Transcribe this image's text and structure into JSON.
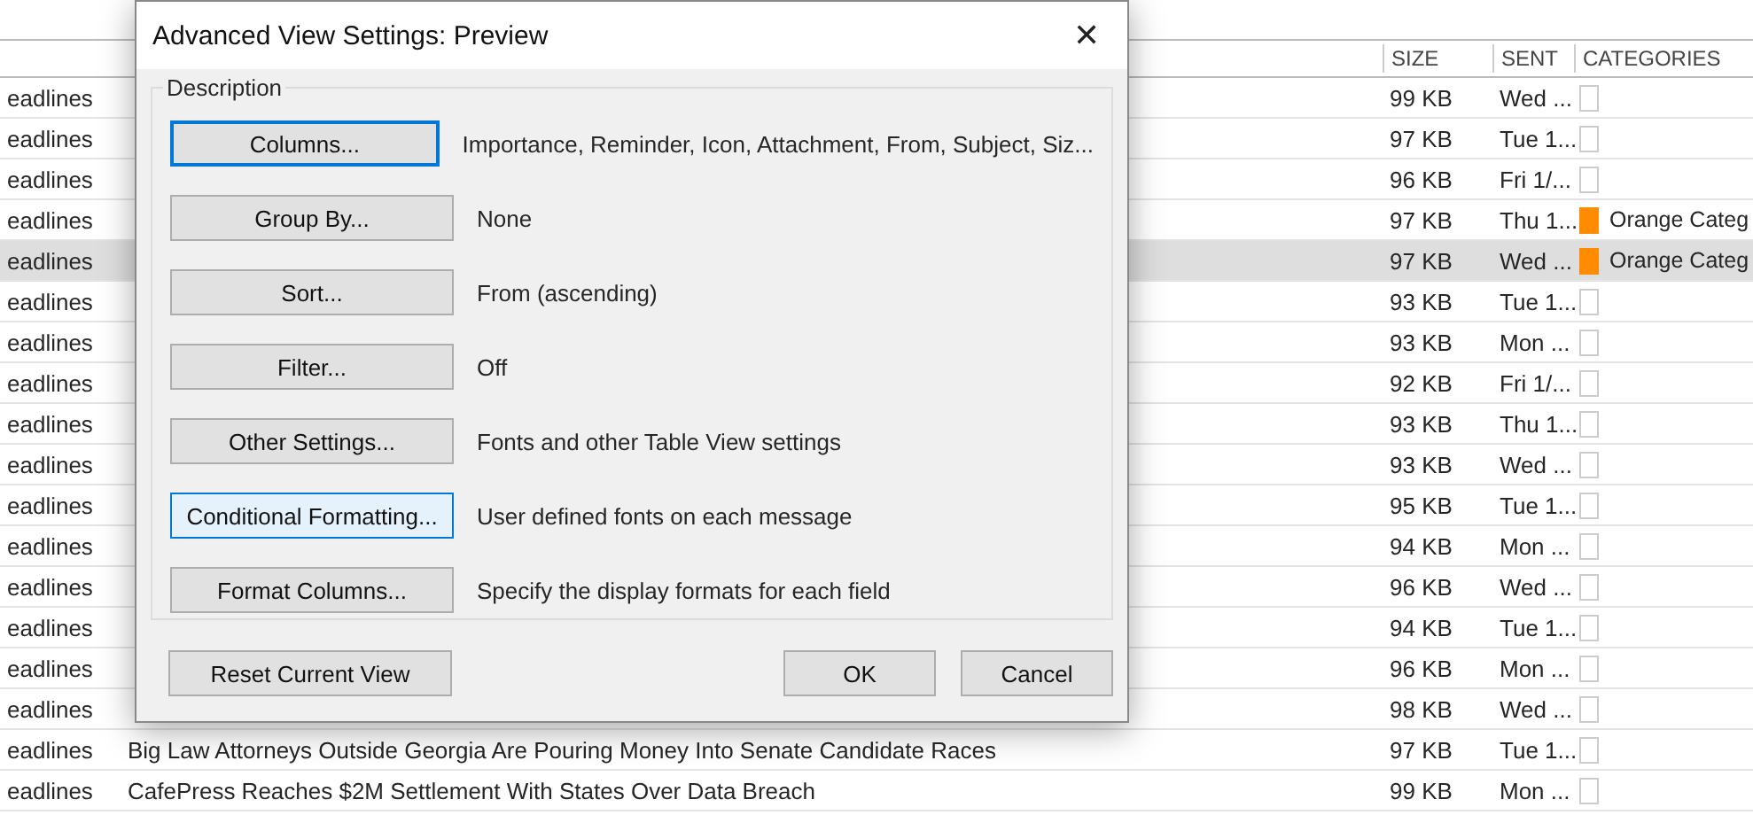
{
  "table": {
    "columns": [
      "",
      "",
      "SIZE",
      "SENT",
      "CATEGORIES"
    ],
    "rows": [
      {
        "from": "eadlines",
        "size": "99 KB",
        "sent": "Wed ...",
        "selected": false
      },
      {
        "from": "eadlines",
        "size": "97 KB",
        "sent": "Tue 1...",
        "selected": false
      },
      {
        "from": "eadlines",
        "size": "96 KB",
        "sent": "Fri 1/...",
        "selected": false
      },
      {
        "from": "eadlines",
        "size": "97 KB",
        "sent": "Thu 1...",
        "selected": false,
        "category": {
          "color": "#ff8c00",
          "label": "Orange Categ"
        }
      },
      {
        "from": "eadlines",
        "size": "97 KB",
        "sent": "Wed ...",
        "selected": true,
        "category": {
          "color": "#ff8c00",
          "label": "Orange Categ"
        }
      },
      {
        "from": "eadlines",
        "size": "93 KB",
        "sent": "Tue 1...",
        "selected": false
      },
      {
        "from": "eadlines",
        "size": "93 KB",
        "sent": "Mon ...",
        "selected": false
      },
      {
        "from": "eadlines",
        "size": "92 KB",
        "sent": "Fri 1/...",
        "selected": false
      },
      {
        "from": "eadlines",
        "size": "93 KB",
        "sent": "Thu 1...",
        "selected": false
      },
      {
        "from": "eadlines",
        "size": "93 KB",
        "sent": "Wed ...",
        "selected": false
      },
      {
        "from": "eadlines",
        "size": "95 KB",
        "sent": "Tue 1...",
        "selected": false
      },
      {
        "from": "eadlines",
        "size": "94 KB",
        "sent": "Mon ...",
        "selected": false
      },
      {
        "from": "eadlines",
        "size": "96 KB",
        "sent": "Wed ...",
        "selected": false
      },
      {
        "from": "eadlines",
        "size": "94 KB",
        "sent": "Tue 1...",
        "selected": false
      },
      {
        "from": "eadlines",
        "size": "96 KB",
        "sent": "Mon ...",
        "selected": false
      },
      {
        "from": "eadlines",
        "size": "98 KB",
        "sent": "Wed ...",
        "selected": false
      },
      {
        "from": "eadlines",
        "subject": "Big Law Attorneys Outside Georgia Are Pouring Money Into Senate Candidate Races",
        "size": "97 KB",
        "sent": "Tue 1...",
        "selected": false
      },
      {
        "from": "eadlines",
        "subject": "CafePress Reaches $2M Settlement With States Over Data Breach",
        "size": "99 KB",
        "sent": "Mon ...",
        "selected": false
      }
    ]
  },
  "dialog": {
    "title": "Advanced View Settings: Preview",
    "close": "✕",
    "group_label": "Description",
    "settings": [
      {
        "button": "Columns...",
        "focused": true,
        "hovered": false,
        "description": "Importance, Reminder, Icon, Attachment, From, Subject, Siz..."
      },
      {
        "button": "Group By...",
        "focused": false,
        "hovered": false,
        "description": "None"
      },
      {
        "button": "Sort...",
        "focused": false,
        "hovered": false,
        "description": "From (ascending)"
      },
      {
        "button": "Filter...",
        "focused": false,
        "hovered": false,
        "description": "Off"
      },
      {
        "button": "Other Settings...",
        "focused": false,
        "hovered": false,
        "description": "Fonts and other Table View settings"
      },
      {
        "button": "Conditional Formatting...",
        "focused": false,
        "hovered": true,
        "description": "User defined fonts on each message"
      },
      {
        "button": "Format Columns...",
        "focused": false,
        "hovered": false,
        "description": "Specify the display formats for each field"
      }
    ],
    "reset": "Reset Current View",
    "ok": "OK",
    "cancel": "Cancel"
  }
}
